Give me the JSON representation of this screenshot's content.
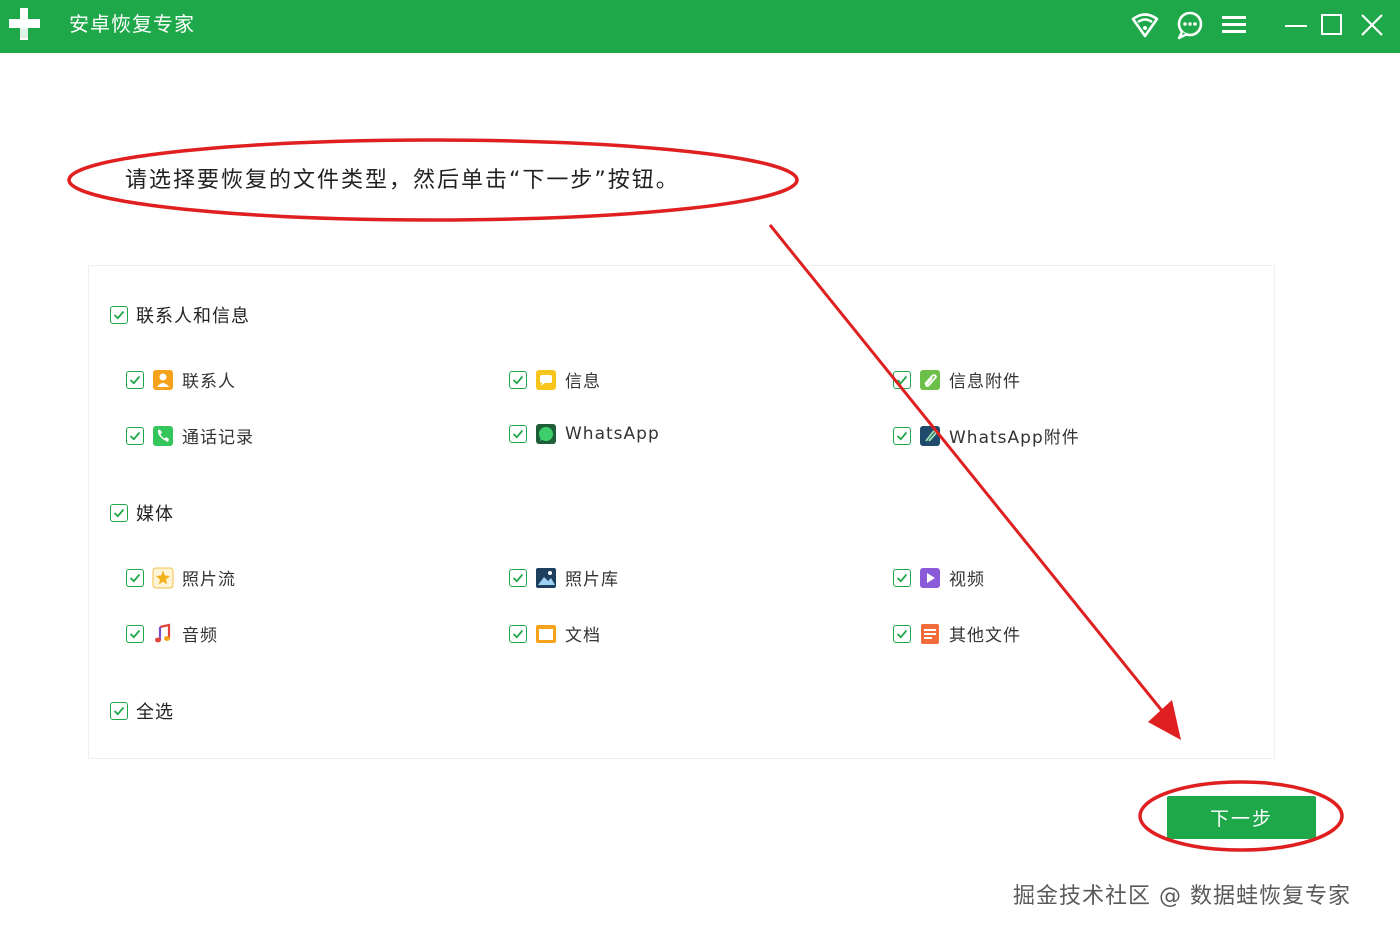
{
  "app": {
    "title": "安卓恢复专家"
  },
  "titlebar": {
    "icons": [
      "wifi-icon",
      "chat-icon",
      "menu-icon",
      "minimize-icon",
      "maximize-icon",
      "close-icon"
    ]
  },
  "instruction": "请选择要恢复的文件类型，然后单击“下一步”按钮。",
  "groups": {
    "contacts": {
      "label": "联系人和信息",
      "checked": true,
      "items": [
        {
          "label": "联系人",
          "icon": "contacts-icon",
          "checked": true
        },
        {
          "label": "信息",
          "icon": "message-icon",
          "checked": true
        },
        {
          "label": "信息附件",
          "icon": "message-attachment-icon",
          "checked": true
        },
        {
          "label": "通话记录",
          "icon": "phone-icon",
          "checked": true
        },
        {
          "label": "WhatsApp",
          "icon": "whatsapp-icon",
          "checked": true
        },
        {
          "label": "WhatsApp附件",
          "icon": "whatsapp-attachment-icon",
          "checked": true
        }
      ]
    },
    "media": {
      "label": "媒体",
      "checked": true,
      "items": [
        {
          "label": "照片流",
          "icon": "photo-stream-icon",
          "checked": true
        },
        {
          "label": "照片库",
          "icon": "photo-library-icon",
          "checked": true
        },
        {
          "label": "视频",
          "icon": "video-icon",
          "checked": true
        },
        {
          "label": "音频",
          "icon": "audio-icon",
          "checked": true
        },
        {
          "label": "文档",
          "icon": "document-icon",
          "checked": true
        },
        {
          "label": "其他文件",
          "icon": "other-file-icon",
          "checked": true
        }
      ]
    }
  },
  "select_all": {
    "label": "全选",
    "checked": true
  },
  "next_button": "下一步",
  "watermark": "掘金技术社区 @ 数据蛙恢复专家",
  "colors": {
    "brand": "#1ea84a",
    "annotation": "#e02020"
  }
}
